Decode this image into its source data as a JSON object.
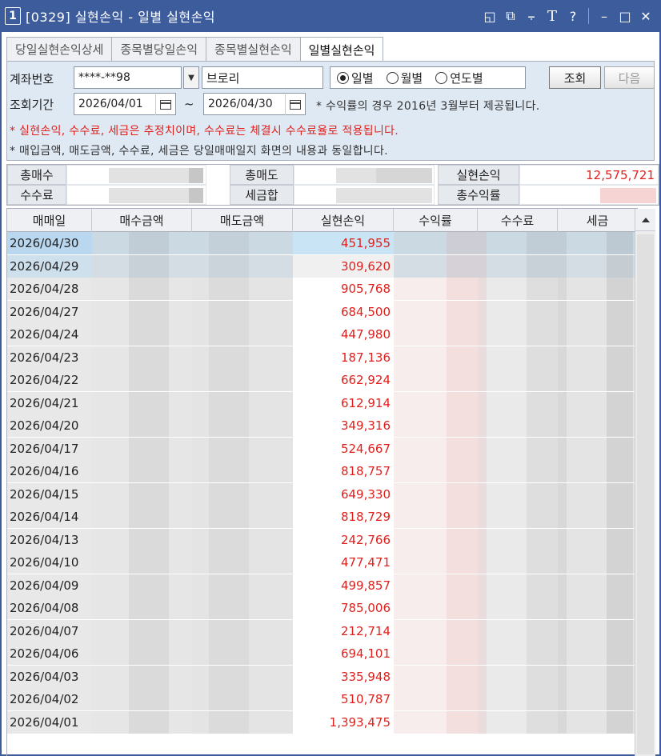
{
  "window": {
    "number": "1",
    "title": "[0329] 실현손익 - 일별 실현손익"
  },
  "tabs": [
    {
      "label": "당일실현손익상세",
      "active": false
    },
    {
      "label": "종목별당일손익",
      "active": false
    },
    {
      "label": "종목별실현손익",
      "active": false
    },
    {
      "label": "일별실현손익",
      "active": true
    }
  ],
  "query": {
    "account_label": "계좌번호",
    "account_value": "****-**98",
    "account_name": "브로리",
    "period_options": [
      {
        "label": "일별",
        "selected": true
      },
      {
        "label": "월별",
        "selected": false
      },
      {
        "label": "연도별",
        "selected": false
      }
    ],
    "search_label": "조회",
    "next_label": "다음",
    "period_label": "조회기간",
    "start_date": "2026/04/01",
    "tilde": "~",
    "end_date": "2026/04/30",
    "period_note": "* 수익률의 경우 2016년 3월부터 제공됩니다.",
    "warning_note": "* 실현손익, 수수료, 세금은 추정치이며, 수수료는 체결시 수수료율로 적용됩니다.",
    "info_note": "* 매입금액, 매도금액, 수수료, 세금은 당일매매일지 화면의 내용과 동일합니다."
  },
  "summary": {
    "total_buy_label": "총매수",
    "total_sell_label": "총매도",
    "realized_pnl_label": "실현손익",
    "realized_pnl_value": "12,575,721",
    "fee_label": "수수료",
    "tax_total_label": "세금합",
    "total_return_label": "총수익률"
  },
  "table": {
    "columns": [
      "매매일",
      "매수금액",
      "매도금액",
      "실현손익",
      "수익률",
      "수수료",
      "세금"
    ],
    "rows": [
      {
        "date": "2026/04/30",
        "pnl": "451,955"
      },
      {
        "date": "2026/04/29",
        "pnl": "309,620"
      },
      {
        "date": "2026/04/28",
        "pnl": "905,768"
      },
      {
        "date": "2026/04/27",
        "pnl": "684,500"
      },
      {
        "date": "2026/04/24",
        "pnl": "447,980"
      },
      {
        "date": "2026/04/23",
        "pnl": "187,136"
      },
      {
        "date": "2026/04/22",
        "pnl": "662,924"
      },
      {
        "date": "2026/04/21",
        "pnl": "612,914"
      },
      {
        "date": "2026/04/20",
        "pnl": "349,316"
      },
      {
        "date": "2026/04/17",
        "pnl": "524,667"
      },
      {
        "date": "2026/04/16",
        "pnl": "818,757"
      },
      {
        "date": "2026/04/15",
        "pnl": "649,330"
      },
      {
        "date": "2026/04/14",
        "pnl": "818,729"
      },
      {
        "date": "2026/04/13",
        "pnl": "242,766"
      },
      {
        "date": "2026/04/10",
        "pnl": "477,471"
      },
      {
        "date": "2026/04/09",
        "pnl": "499,857"
      },
      {
        "date": "2026/04/08",
        "pnl": "785,006"
      },
      {
        "date": "2026/04/07",
        "pnl": "212,714"
      },
      {
        "date": "2026/04/06",
        "pnl": "694,101"
      },
      {
        "date": "2026/04/03",
        "pnl": "335,948"
      },
      {
        "date": "2026/04/02",
        "pnl": "510,787"
      },
      {
        "date": "2026/04/01",
        "pnl": "1,393,475"
      }
    ]
  },
  "colors": {
    "titlebar": "#3d5c9c",
    "panel_bg": "#dfe9f4",
    "profit_text": "#e0201c",
    "selected_row": "#b9d8f0"
  }
}
